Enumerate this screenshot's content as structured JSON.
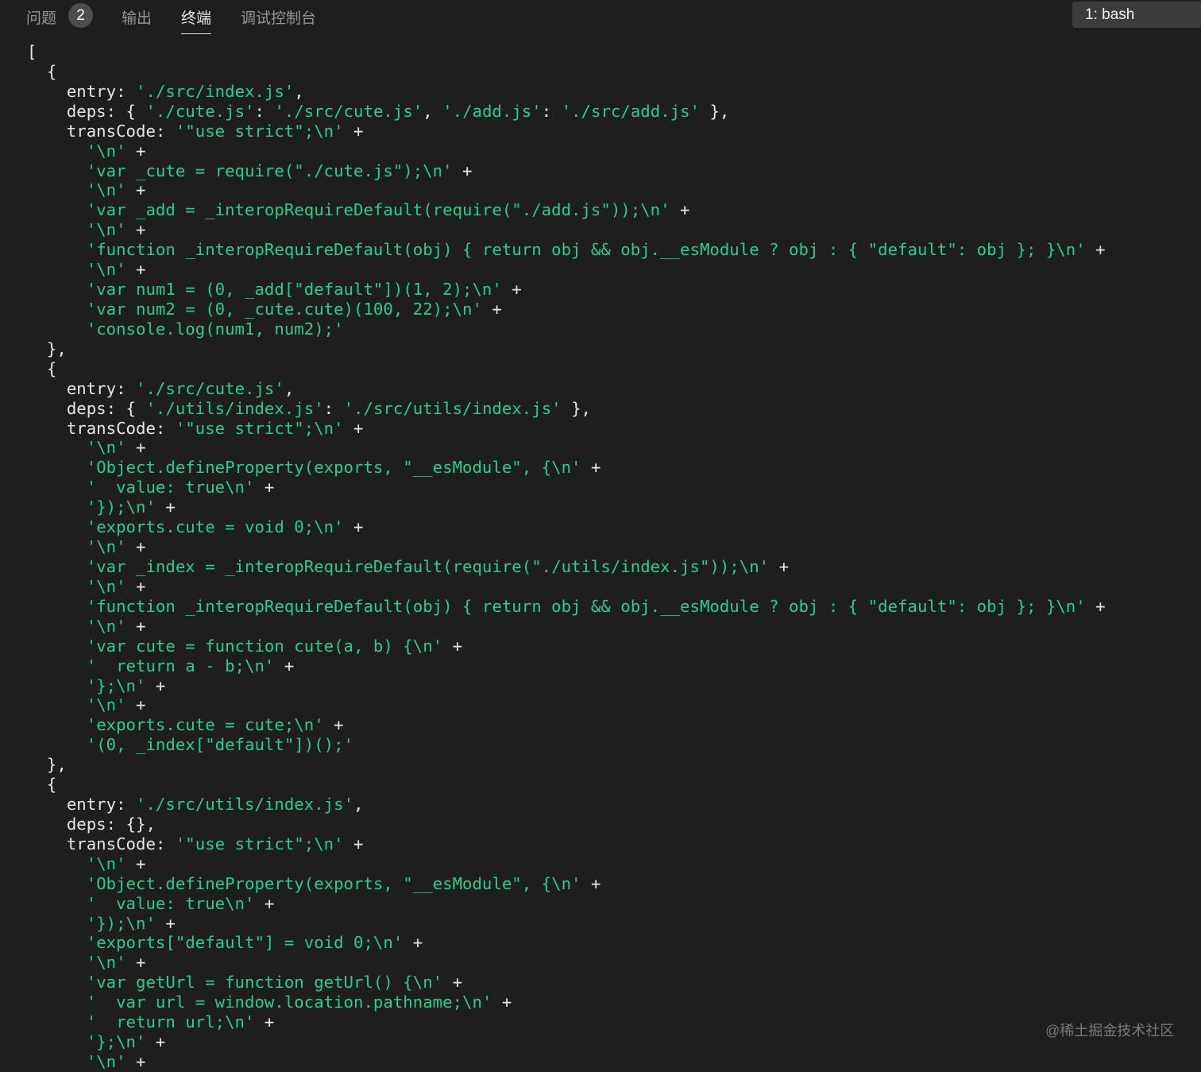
{
  "panel": {
    "tabs": [
      {
        "label": "问题",
        "badge": "2"
      },
      {
        "label": "输出"
      },
      {
        "label": "终端"
      },
      {
        "label": "调试控制台"
      }
    ],
    "active_tab": "终端",
    "terminal_selector": "1: bash"
  },
  "colors": {
    "background": "#1e1e1e",
    "text": "#e6e6e6",
    "string": "#23d18b"
  },
  "terminal": {
    "lines": [
      [
        {
          "t": "["
        }
      ],
      [
        {
          "t": "  {"
        }
      ],
      [
        {
          "t": "    entry: "
        },
        {
          "t": "'./src/index.js'",
          "s": 1
        },
        {
          "t": ","
        }
      ],
      [
        {
          "t": "    deps: { "
        },
        {
          "t": "'./cute.js'",
          "s": 1
        },
        {
          "t": ": "
        },
        {
          "t": "'./src/cute.js'",
          "s": 1
        },
        {
          "t": ", "
        },
        {
          "t": "'./add.js'",
          "s": 1
        },
        {
          "t": ": "
        },
        {
          "t": "'./src/add.js'",
          "s": 1
        },
        {
          "t": " },"
        }
      ],
      [
        {
          "t": "    transCode: "
        },
        {
          "t": "'\"use strict\";\\n'",
          "s": 1
        },
        {
          "t": " +"
        }
      ],
      [
        {
          "t": "      "
        },
        {
          "t": "'\\n'",
          "s": 1
        },
        {
          "t": " +"
        }
      ],
      [
        {
          "t": "      "
        },
        {
          "t": "'var _cute = require(\"./cute.js\");\\n'",
          "s": 1
        },
        {
          "t": " +"
        }
      ],
      [
        {
          "t": "      "
        },
        {
          "t": "'\\n'",
          "s": 1
        },
        {
          "t": " +"
        }
      ],
      [
        {
          "t": "      "
        },
        {
          "t": "'var _add = _interopRequireDefault(require(\"./add.js\"));\\n'",
          "s": 1
        },
        {
          "t": " +"
        }
      ],
      [
        {
          "t": "      "
        },
        {
          "t": "'\\n'",
          "s": 1
        },
        {
          "t": " +"
        }
      ],
      [
        {
          "t": "      "
        },
        {
          "t": "'function _interopRequireDefault(obj) { return obj && obj.__esModule ? obj : { \"default\": obj }; }\\n'",
          "s": 1
        },
        {
          "t": " +"
        }
      ],
      [
        {
          "t": "      "
        },
        {
          "t": "'\\n'",
          "s": 1
        },
        {
          "t": " +"
        }
      ],
      [
        {
          "t": "      "
        },
        {
          "t": "'var num1 = (0, _add[\"default\"])(1, 2);\\n'",
          "s": 1
        },
        {
          "t": " +"
        }
      ],
      [
        {
          "t": "      "
        },
        {
          "t": "'var num2 = (0, _cute.cute)(100, 22);\\n'",
          "s": 1
        },
        {
          "t": " +"
        }
      ],
      [
        {
          "t": "      "
        },
        {
          "t": "'console.log(num1, num2);'",
          "s": 1
        }
      ],
      [
        {
          "t": "  },"
        }
      ],
      [
        {
          "t": "  {"
        }
      ],
      [
        {
          "t": "    entry: "
        },
        {
          "t": "'./src/cute.js'",
          "s": 1
        },
        {
          "t": ","
        }
      ],
      [
        {
          "t": "    deps: { "
        },
        {
          "t": "'./utils/index.js'",
          "s": 1
        },
        {
          "t": ": "
        },
        {
          "t": "'./src/utils/index.js'",
          "s": 1
        },
        {
          "t": " },"
        }
      ],
      [
        {
          "t": "    transCode: "
        },
        {
          "t": "'\"use strict\";\\n'",
          "s": 1
        },
        {
          "t": " +"
        }
      ],
      [
        {
          "t": "      "
        },
        {
          "t": "'\\n'",
          "s": 1
        },
        {
          "t": " +"
        }
      ],
      [
        {
          "t": "      "
        },
        {
          "t": "'Object.defineProperty(exports, \"__esModule\", {\\n'",
          "s": 1
        },
        {
          "t": " +"
        }
      ],
      [
        {
          "t": "      "
        },
        {
          "t": "'  value: true\\n'",
          "s": 1
        },
        {
          "t": " +"
        }
      ],
      [
        {
          "t": "      "
        },
        {
          "t": "'});\\n'",
          "s": 1
        },
        {
          "t": " +"
        }
      ],
      [
        {
          "t": "      "
        },
        {
          "t": "'exports.cute = void 0;\\n'",
          "s": 1
        },
        {
          "t": " +"
        }
      ],
      [
        {
          "t": "      "
        },
        {
          "t": "'\\n'",
          "s": 1
        },
        {
          "t": " +"
        }
      ],
      [
        {
          "t": "      "
        },
        {
          "t": "'var _index = _interopRequireDefault(require(\"./utils/index.js\"));\\n'",
          "s": 1
        },
        {
          "t": " +"
        }
      ],
      [
        {
          "t": "      "
        },
        {
          "t": "'\\n'",
          "s": 1
        },
        {
          "t": " +"
        }
      ],
      [
        {
          "t": "      "
        },
        {
          "t": "'function _interopRequireDefault(obj) { return obj && obj.__esModule ? obj : { \"default\": obj }; }\\n'",
          "s": 1
        },
        {
          "t": " +"
        }
      ],
      [
        {
          "t": "      "
        },
        {
          "t": "'\\n'",
          "s": 1
        },
        {
          "t": " +"
        }
      ],
      [
        {
          "t": "      "
        },
        {
          "t": "'var cute = function cute(a, b) {\\n'",
          "s": 1
        },
        {
          "t": " +"
        }
      ],
      [
        {
          "t": "      "
        },
        {
          "t": "'  return a - b;\\n'",
          "s": 1
        },
        {
          "t": " +"
        }
      ],
      [
        {
          "t": "      "
        },
        {
          "t": "'};\\n'",
          "s": 1
        },
        {
          "t": " +"
        }
      ],
      [
        {
          "t": "      "
        },
        {
          "t": "'\\n'",
          "s": 1
        },
        {
          "t": " +"
        }
      ],
      [
        {
          "t": "      "
        },
        {
          "t": "'exports.cute = cute;\\n'",
          "s": 1
        },
        {
          "t": " +"
        }
      ],
      [
        {
          "t": "      "
        },
        {
          "t": "'(0, _index[\"default\"])();'",
          "s": 1
        }
      ],
      [
        {
          "t": "  },"
        }
      ],
      [
        {
          "t": "  {"
        }
      ],
      [
        {
          "t": "    entry: "
        },
        {
          "t": "'./src/utils/index.js'",
          "s": 1
        },
        {
          "t": ","
        }
      ],
      [
        {
          "t": "    deps: {},"
        }
      ],
      [
        {
          "t": "    transCode: "
        },
        {
          "t": "'\"use strict\";\\n'",
          "s": 1
        },
        {
          "t": " +"
        }
      ],
      [
        {
          "t": "      "
        },
        {
          "t": "'\\n'",
          "s": 1
        },
        {
          "t": " +"
        }
      ],
      [
        {
          "t": "      "
        },
        {
          "t": "'Object.defineProperty(exports, \"__esModule\", {\\n'",
          "s": 1
        },
        {
          "t": " +"
        }
      ],
      [
        {
          "t": "      "
        },
        {
          "t": "'  value: true\\n'",
          "s": 1
        },
        {
          "t": " +"
        }
      ],
      [
        {
          "t": "      "
        },
        {
          "t": "'});\\n'",
          "s": 1
        },
        {
          "t": " +"
        }
      ],
      [
        {
          "t": "      "
        },
        {
          "t": "'exports[\"default\"] = void 0;\\n'",
          "s": 1
        },
        {
          "t": " +"
        }
      ],
      [
        {
          "t": "      "
        },
        {
          "t": "'\\n'",
          "s": 1
        },
        {
          "t": " +"
        }
      ],
      [
        {
          "t": "      "
        },
        {
          "t": "'var getUrl = function getUrl() {\\n'",
          "s": 1
        },
        {
          "t": " +"
        }
      ],
      [
        {
          "t": "      "
        },
        {
          "t": "'  var url = window.location.pathname;\\n'",
          "s": 1
        },
        {
          "t": " +"
        }
      ],
      [
        {
          "t": "      "
        },
        {
          "t": "'  return url;\\n'",
          "s": 1
        },
        {
          "t": " +"
        }
      ],
      [
        {
          "t": "      "
        },
        {
          "t": "'};\\n'",
          "s": 1
        },
        {
          "t": " +"
        }
      ],
      [
        {
          "t": "      "
        },
        {
          "t": "'\\n'",
          "s": 1
        },
        {
          "t": " +"
        }
      ]
    ]
  },
  "watermark": "@稀土掘金技术社区"
}
